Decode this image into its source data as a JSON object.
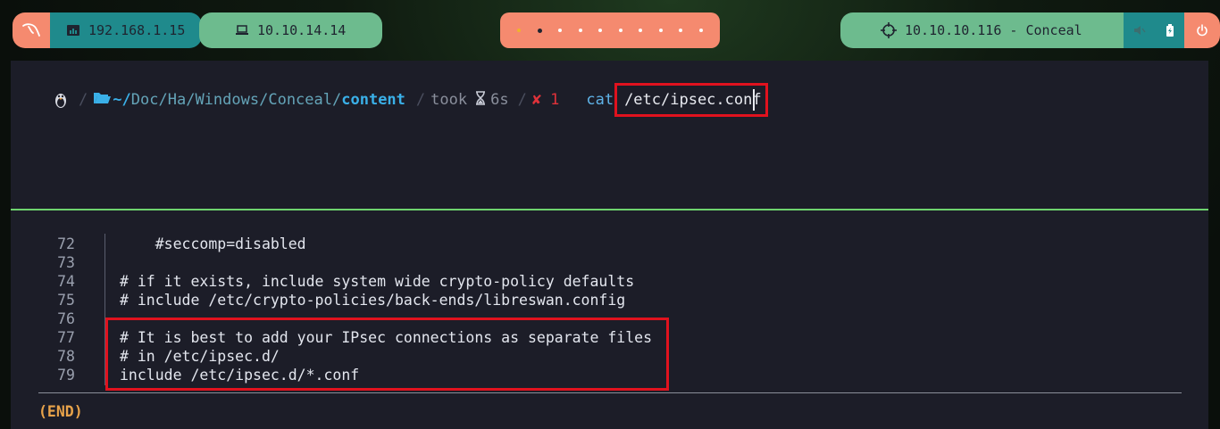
{
  "topbar": {
    "left_ip": "192.168.1.15",
    "vpn_ip": "10.10.14.14",
    "target": "10.10.10.116 - Conceal",
    "workspaces": 8,
    "active_workspace": 2
  },
  "prompt": {
    "home_part": "~/",
    "dir1": "Doc",
    "dir2": "Ha",
    "dir3": "Windows",
    "dir4": "Conceal",
    "current_dir": "content",
    "took_label": "took",
    "took_value": "6s",
    "exit_code": "1",
    "command": "cat",
    "argument": "/etc/ipsec.conf"
  },
  "pager": {
    "lines": [
      {
        "num": "72",
        "text": "    #seccomp=disabled"
      },
      {
        "num": "73",
        "text": ""
      },
      {
        "num": "74",
        "text": "# if it exists, include system wide crypto-policy defaults"
      },
      {
        "num": "75",
        "text": "# include /etc/crypto-policies/back-ends/libreswan.config"
      },
      {
        "num": "76",
        "text": ""
      },
      {
        "num": "77",
        "text": "# It is best to add your IPsec connections as separate files"
      },
      {
        "num": "78",
        "text": "# in /etc/ipsec.d/"
      },
      {
        "num": "79",
        "text": "include /etc/ipsec.d/*.conf"
      }
    ],
    "status": "(END)"
  },
  "colors": {
    "accent_salmon": "#f58a6f",
    "accent_teal": "#1f8a8c",
    "accent_green": "#6dbb8e",
    "highlight_red": "#e0121e"
  }
}
